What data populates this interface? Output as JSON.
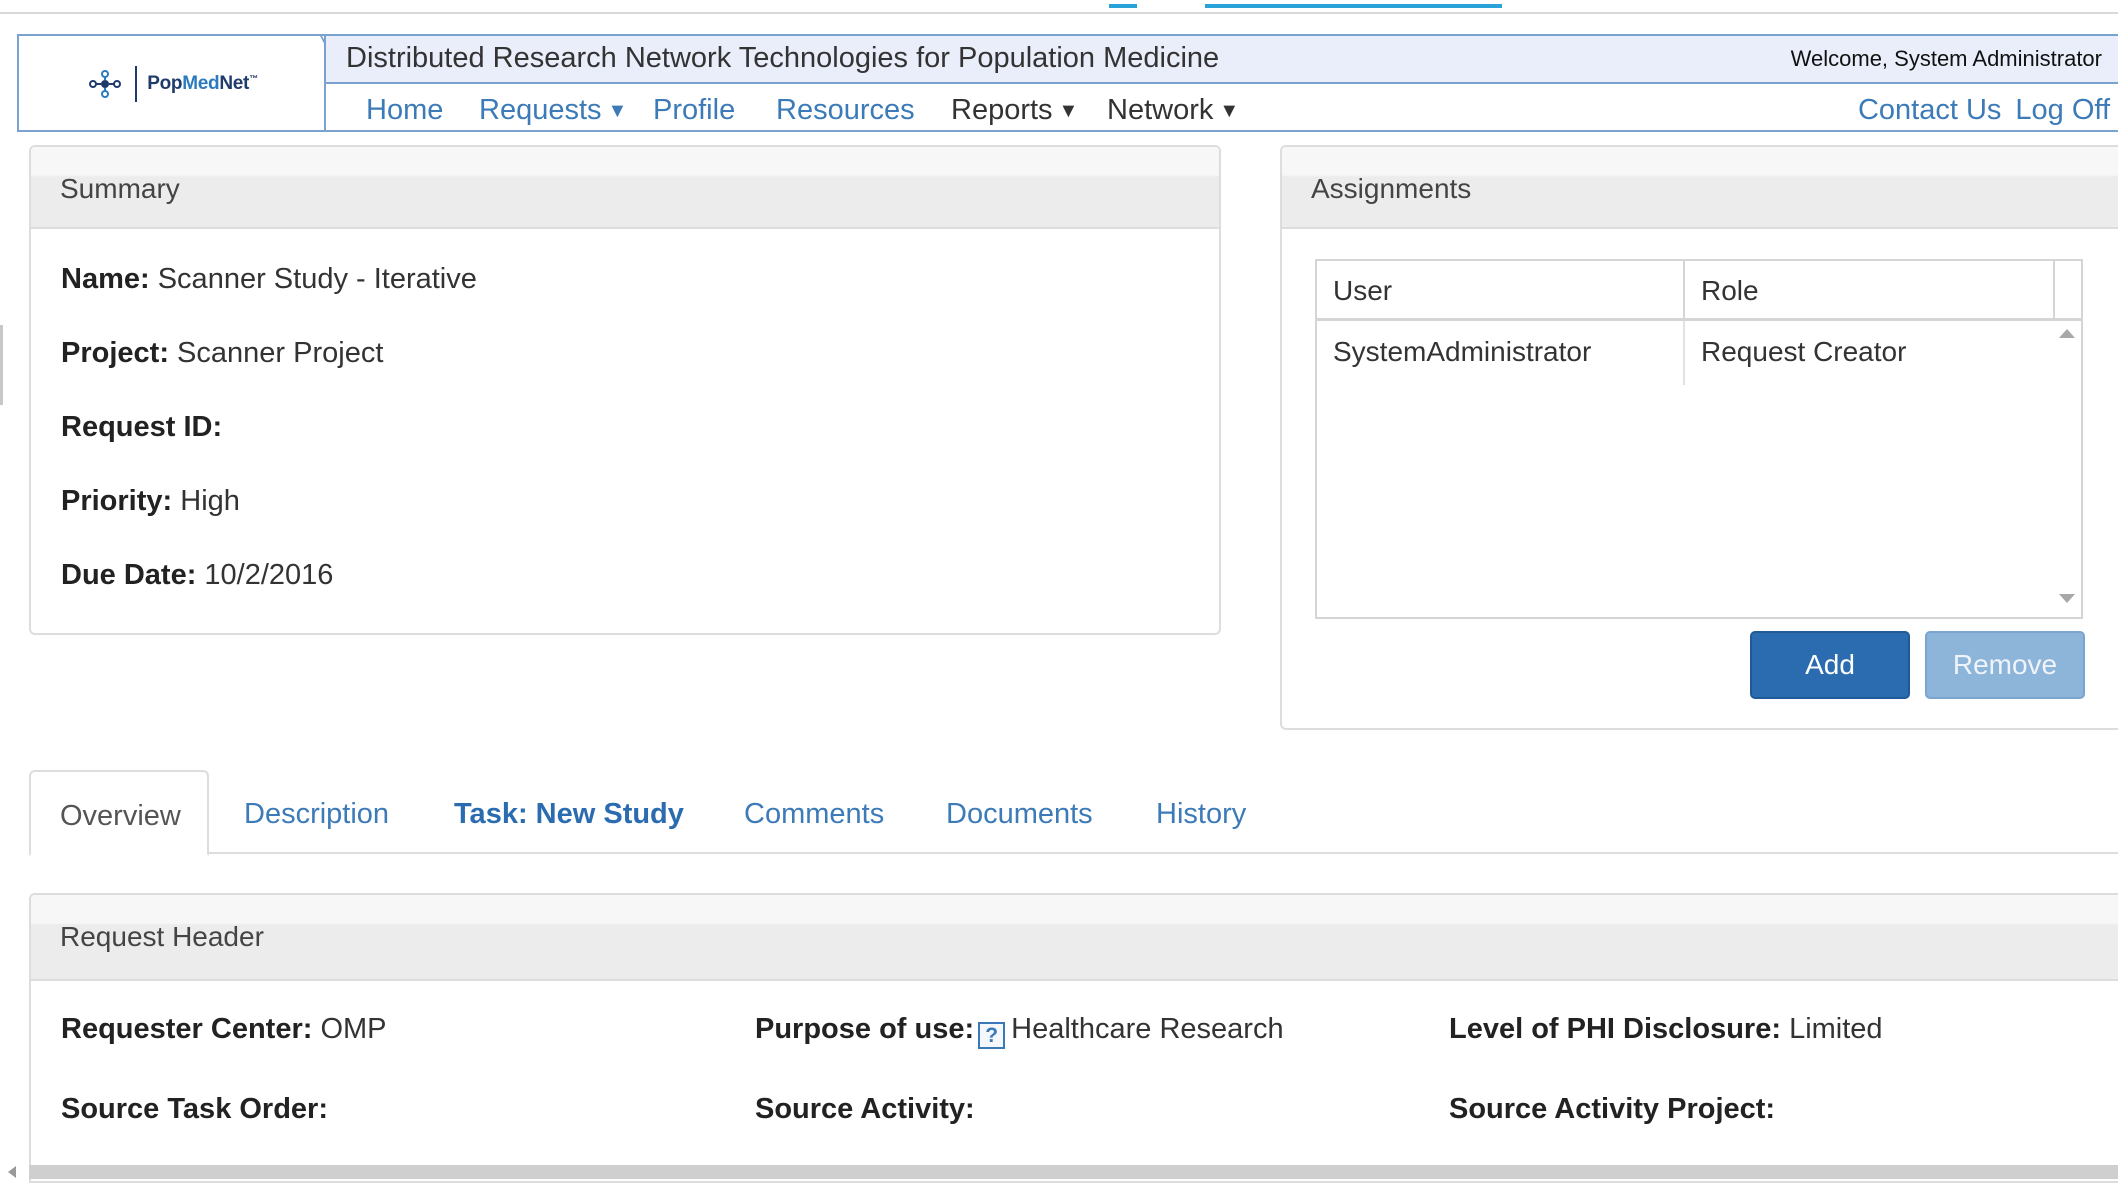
{
  "header": {
    "logo_text_pop": "Pop",
    "logo_text_med": "Med",
    "logo_text_net": "Net",
    "app_title": "Distributed Research Network Technologies for Population Medicine",
    "welcome": "Welcome, System Administrator"
  },
  "nav": {
    "items": [
      {
        "label": "Home"
      },
      {
        "label": "Requests"
      },
      {
        "label": "Profile"
      },
      {
        "label": "Resources"
      },
      {
        "label": "Reports"
      },
      {
        "label": "Network"
      }
    ],
    "contact": "Contact Us",
    "logoff": "Log Off",
    "caret": "▼"
  },
  "summary": {
    "title": "Summary",
    "name_label": "Name:",
    "name_value": "Scanner Study - Iterative",
    "project_label": "Project:",
    "project_value": "Scanner Project",
    "request_id_label": "Request ID:",
    "request_id_value": "",
    "priority_label": "Priority:",
    "priority_value": "High",
    "due_date_label": "Due Date:",
    "due_date_value": "10/2/2016"
  },
  "assignments": {
    "title": "Assignments",
    "columns": [
      "User",
      "Role"
    ],
    "rows": [
      {
        "user": "SystemAdministrator",
        "role": "Request Creator"
      }
    ],
    "add_label": "Add",
    "remove_label": "Remove"
  },
  "tabs": [
    {
      "label": "Overview",
      "active": true
    },
    {
      "label": "Description"
    },
    {
      "label": "Task: New Study"
    },
    {
      "label": "Comments"
    },
    {
      "label": "Documents"
    },
    {
      "label": "History"
    }
  ],
  "request_header": {
    "title": "Request Header",
    "requester_center_label": "Requester Center:",
    "requester_center_value": "OMP",
    "purpose_label": "Purpose of use:",
    "purpose_help": "?",
    "purpose_value": "Healthcare Research",
    "phi_label": "Level of PHI Disclosure:",
    "phi_value": "Limited",
    "source_task_order_label": "Source Task Order:",
    "source_activity_label": "Source Activity:",
    "source_activity_project_label": "Source Activity Project:"
  },
  "colors": {
    "link": "#3c7ab8",
    "primary_button": "#2b6cb0",
    "disabled_button": "#8db4d9",
    "header_border": "#7aa2cf"
  }
}
